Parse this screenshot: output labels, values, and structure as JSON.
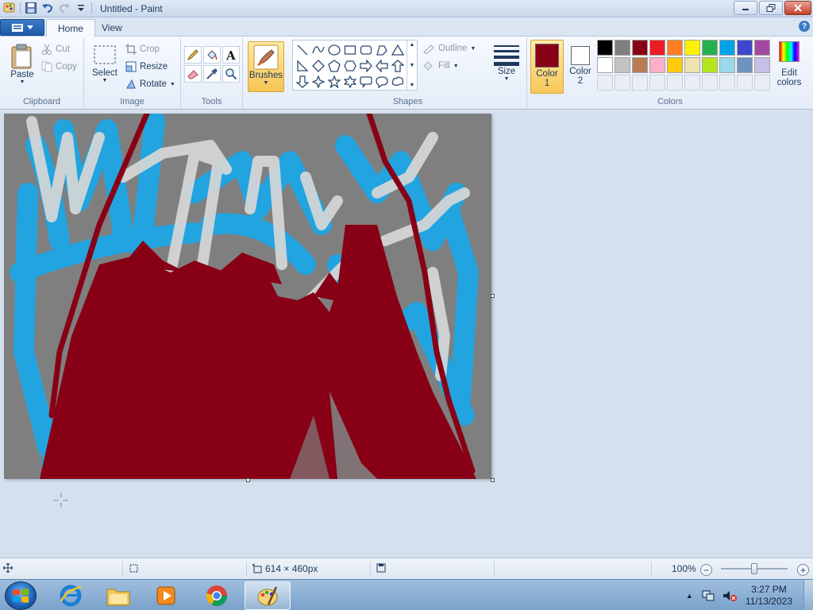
{
  "window": {
    "title": "Untitled - Paint"
  },
  "tabs": [
    {
      "label": "Home"
    },
    {
      "label": "View"
    }
  ],
  "clipboard": {
    "paste": "Paste",
    "cut": "Cut",
    "copy": "Copy",
    "group": "Clipboard"
  },
  "image": {
    "select": "Select",
    "crop": "Crop",
    "resize": "Resize",
    "rotate": "Rotate",
    "group": "Image"
  },
  "tools": {
    "group": "Tools"
  },
  "brushes": {
    "label": "Brushes"
  },
  "shapes": {
    "outline": "Outline",
    "fill": "Fill",
    "group": "Shapes"
  },
  "size": {
    "label": "Size"
  },
  "colors": {
    "color1_label": "Color",
    "color1_num": "1",
    "color2_label": "Color",
    "color2_num": "2",
    "edit_label_1": "Edit",
    "edit_label_2": "colors",
    "group": "Colors",
    "color1": "#880015",
    "color2": "#ffffff",
    "palette_row1": [
      "#000000",
      "#7f7f7f",
      "#880015",
      "#ed1c24",
      "#ff7f27",
      "#fff200",
      "#22b14c",
      "#00a2e8",
      "#3f48cc",
      "#a349a4"
    ],
    "palette_row2": [
      "#ffffff",
      "#c3c3c3",
      "#b97a57",
      "#ffaec9",
      "#ffc90e",
      "#efe4b0",
      "#b5e61d",
      "#99d9ea",
      "#7092be",
      "#c8bfe7"
    ]
  },
  "canvas": {
    "background": "#7f7f7f",
    "stroke_colors": {
      "blue": "#1ea6e6",
      "light": "#d7d7d7",
      "red": "#880015"
    }
  },
  "status": {
    "image_size": "614 × 460px",
    "zoom": "100%"
  },
  "taskbar": {
    "time": "3:27 PM",
    "date": "11/13/2023"
  }
}
